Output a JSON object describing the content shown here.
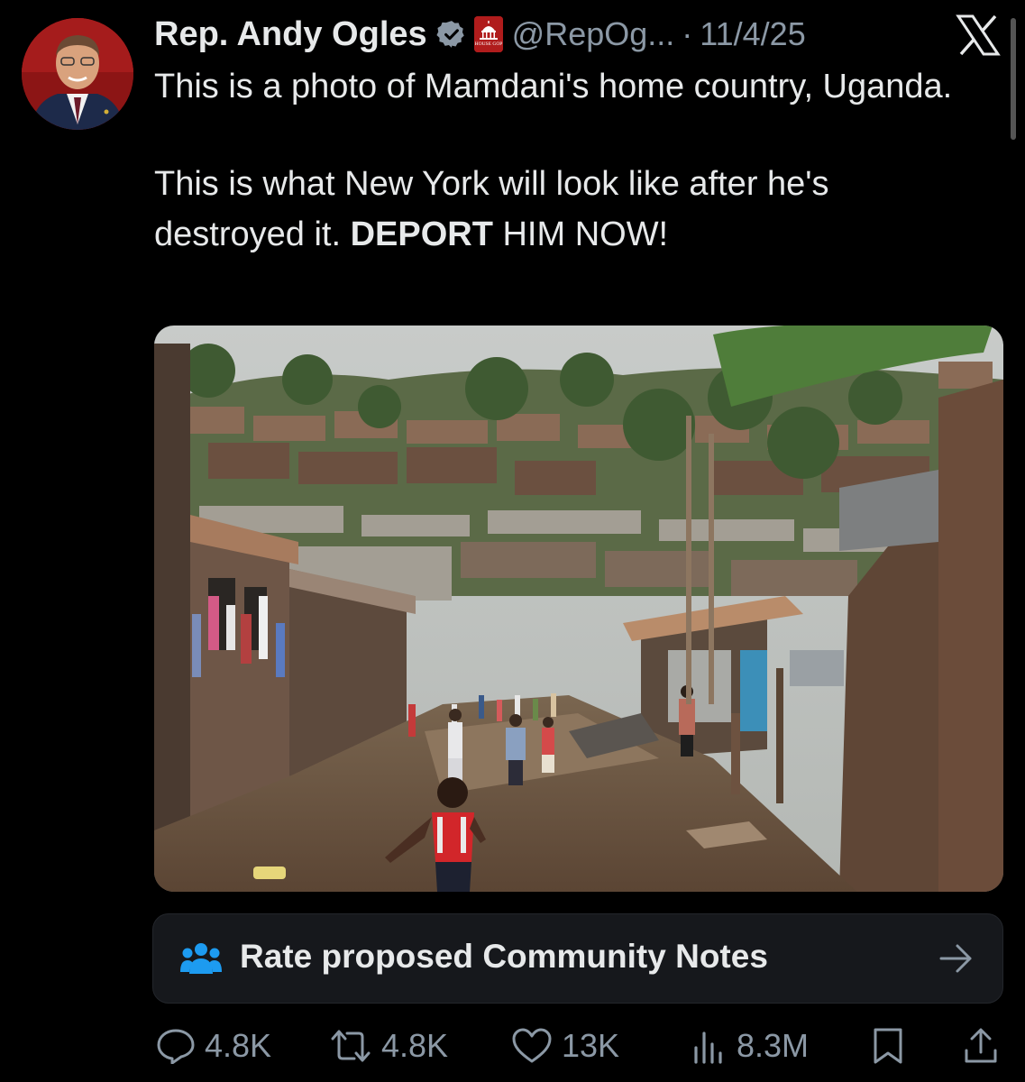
{
  "post": {
    "author_name": "Rep. Andy Ogles",
    "gop_badge_text": "HOUSE GOP",
    "handle": "@RepOg...",
    "separator": "·",
    "date": "11/4/25",
    "text_line1": "This is a photo of Mamdani's home country, Uganda.",
    "text_line2_plain": "This is what New York will look like after he's destroyed it. ",
    "text_line2_bold": "DEPORT",
    "text_line2_end": " HIM NOW!"
  },
  "community_notes": {
    "label": "Rate proposed Community Notes"
  },
  "actions": {
    "replies": "4.8K",
    "reposts": "4.8K",
    "likes": "13K",
    "views": "8.3M"
  },
  "colors": {
    "background": "#000000",
    "text": "#e7e9ea",
    "secondary": "#8b98a5",
    "verified": "#8b98a5",
    "notes_icon": "#1d9bf0"
  }
}
